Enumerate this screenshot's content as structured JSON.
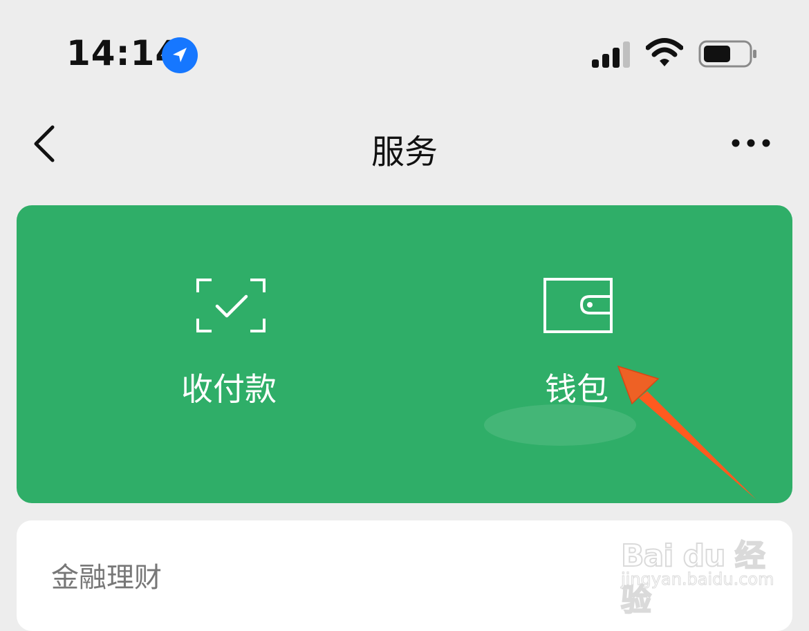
{
  "status_bar": {
    "time": "14:14",
    "location_icon": "location-arrow-icon",
    "signal_icon": "cellular-signal-icon",
    "wifi_icon": "wifi-icon",
    "battery_icon": "battery-icon"
  },
  "nav": {
    "back_icon": "chevron-left-icon",
    "title": "服务",
    "more_icon": "more-dots-icon"
  },
  "green_card": {
    "background": "#2fae68",
    "actions": [
      {
        "label": "收付款",
        "icon": "scan-check-icon"
      },
      {
        "label": "钱包",
        "icon": "wallet-icon"
      }
    ]
  },
  "annotation": {
    "color": "#ff5a1f",
    "icon": "pointer-arrow-icon"
  },
  "finance_section": {
    "title": "金融理财"
  },
  "watermark": {
    "logo_text": "Bai du 经验",
    "url": "jingyan.baidu.com"
  }
}
